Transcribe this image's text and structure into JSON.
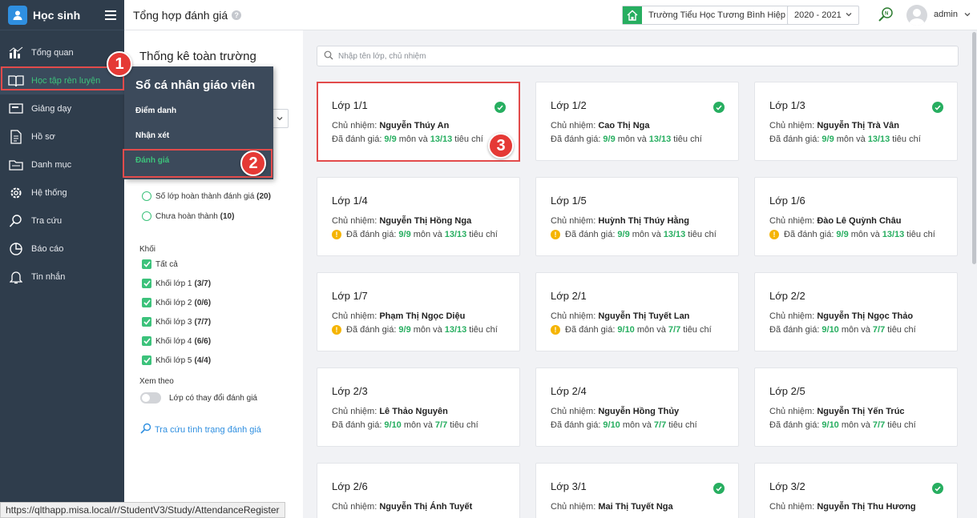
{
  "app": {
    "name": "Học sinh"
  },
  "sidebar": {
    "items": [
      {
        "label": "Tổng quan",
        "icon": "bar-chart-icon"
      },
      {
        "label": "Học tập rèn luyện",
        "icon": "book-icon"
      },
      {
        "label": "Giảng dạy",
        "icon": "board-icon"
      },
      {
        "label": "Hồ sơ",
        "icon": "document-icon"
      },
      {
        "label": "Danh mục",
        "icon": "folder-icon"
      },
      {
        "label": "Hệ thống",
        "icon": "gear-icon"
      },
      {
        "label": "Tra cứu",
        "icon": "search-icon"
      },
      {
        "label": "Báo cáo",
        "icon": "pie-chart-icon"
      },
      {
        "label": "Tin nhắn",
        "icon": "bell-icon"
      }
    ]
  },
  "header": {
    "title": "Tổng hợp đánh giá",
    "help": "?",
    "school": "Trường Tiểu Học Tương Bình Hiệp",
    "year": "2020 - 2021",
    "user": "admin"
  },
  "dropdown": {
    "title": "Sổ cá nhân giáo viên",
    "items": [
      "Điểm danh",
      "Nhận xét",
      "Đánh giá"
    ]
  },
  "filter": {
    "title": "Thống kê toàn trường",
    "radios": [
      {
        "label": "Số lớp hoàn thành đánh giá",
        "count": "(20)"
      },
      {
        "label": "Chưa hoàn thành",
        "count": "(10)"
      }
    ],
    "khoi_label": "Khối",
    "grades": [
      {
        "label": "Tất cả",
        "count": ""
      },
      {
        "label": "Khối lớp 1",
        "count": "(3/7)"
      },
      {
        "label": "Khối lớp 2",
        "count": "(0/6)"
      },
      {
        "label": "Khối lớp 3",
        "count": "(7/7)"
      },
      {
        "label": "Khối lớp 4",
        "count": "(6/6)"
      },
      {
        "label": "Khối lớp 5",
        "count": "(4/4)"
      }
    ],
    "view_label": "Xem theo",
    "toggle_label": "Lớp có thay đổi đánh giá",
    "lookup_link": "Tra cứu tình trạng đánh giá"
  },
  "search": {
    "placeholder": "Nhập tên lớp, chủ nhiệm"
  },
  "card_labels": {
    "teacher_prefix": "Chủ nhiệm:",
    "eval_prefix": "Đã đánh giá:",
    "subject_word": "môn và",
    "criteria_word": "tiêu chí"
  },
  "classes": [
    {
      "name": "Lớp 1/1",
      "teacher": "Nguyễn Thúy An",
      "subjects": "9/9",
      "criteria": "13/13",
      "status": "done"
    },
    {
      "name": "Lớp 1/2",
      "teacher": "Cao Thị Nga",
      "subjects": "9/9",
      "criteria": "13/13",
      "status": "done"
    },
    {
      "name": "Lớp 1/3",
      "teacher": "Nguyễn Thị Trà Vân",
      "subjects": "9/9",
      "criteria": "13/13",
      "status": "done"
    },
    {
      "name": "Lớp 1/4",
      "teacher": "Nguyễn Thị Hồng Nga",
      "subjects": "9/9",
      "criteria": "13/13",
      "status": "warn"
    },
    {
      "name": "Lớp 1/5",
      "teacher": "Huỳnh Thị Thúy Hằng",
      "subjects": "9/9",
      "criteria": "13/13",
      "status": "warn"
    },
    {
      "name": "Lớp 1/6",
      "teacher": "Đào Lê Quỳnh Châu",
      "subjects": "9/9",
      "criteria": "13/13",
      "status": "warn"
    },
    {
      "name": "Lớp 1/7",
      "teacher": "Phạm Thị Ngọc Diệu",
      "subjects": "9/9",
      "criteria": "13/13",
      "status": "warn"
    },
    {
      "name": "Lớp 2/1",
      "teacher": "Nguyễn Thị Tuyết Lan",
      "subjects": "9/10",
      "criteria": "7/7",
      "status": "warn"
    },
    {
      "name": "Lớp 2/2",
      "teacher": "Nguyễn Thị Ngọc Thảo",
      "subjects": "9/10",
      "criteria": "7/7",
      "status": "none"
    },
    {
      "name": "Lớp 2/3",
      "teacher": "Lê Thảo Nguyên",
      "subjects": "9/10",
      "criteria": "7/7",
      "status": "none"
    },
    {
      "name": "Lớp 2/4",
      "teacher": "Nguyễn Hồng Thủy",
      "subjects": "9/10",
      "criteria": "7/7",
      "status": "none"
    },
    {
      "name": "Lớp 2/5",
      "teacher": "Nguyễn Thị Yến Trúc",
      "subjects": "9/10",
      "criteria": "7/7",
      "status": "none"
    },
    {
      "name": "Lớp 2/6",
      "teacher": "Nguyễn Thị Ánh Tuyết",
      "subjects": "",
      "criteria": "",
      "status": "none"
    },
    {
      "name": "Lớp 3/1",
      "teacher": "Mai Thị Tuyết Nga",
      "subjects": "",
      "criteria": "",
      "status": "done"
    },
    {
      "name": "Lớp 3/2",
      "teacher": "Nguyễn Thị Thu Hương",
      "subjects": "",
      "criteria": "",
      "status": "done"
    }
  ],
  "callouts": [
    "1",
    "2",
    "3"
  ],
  "status_url": "https://qlthapp.misa.local/r/StudentV3/Study/AttendanceRegister",
  "colors": {
    "accent_green": "#3cc27b",
    "sidebar_bg": "#2f3d4c",
    "highlight_red": "#e24b4b",
    "warning": "#f5b400"
  }
}
